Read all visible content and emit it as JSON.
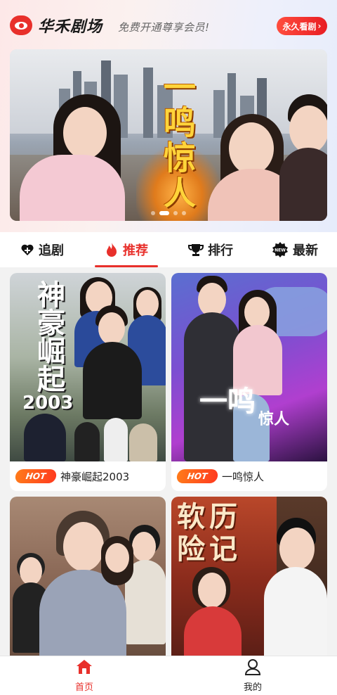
{
  "header": {
    "app_name": "华禾剧场",
    "slogan": "免费开通尊享会员!",
    "vip_button": "永久看剧"
  },
  "banner": {
    "title": "一鸣惊人"
  },
  "tabs": [
    {
      "label": "追剧",
      "icon": "heart-plus-icon",
      "active": false
    },
    {
      "label": "推荐",
      "icon": "flame-icon",
      "active": true
    },
    {
      "label": "排行",
      "icon": "trophy-icon",
      "active": false
    },
    {
      "label": "最新",
      "icon": "new-badge-icon",
      "active": false
    }
  ],
  "cards": [
    {
      "badge": "HOT",
      "title": "神豪崛起2003",
      "poster_text": "神豪崛起",
      "poster_year": "2003"
    },
    {
      "badge": "HOT",
      "title": "一鸣惊人",
      "poster_text_a": "一鸣",
      "poster_text_b": "惊人"
    },
    {
      "badge": "",
      "title": "",
      "poster_text": ""
    },
    {
      "badge": "",
      "title": "",
      "poster_text": "软历险记"
    }
  ],
  "bottom_nav": [
    {
      "label": "首页",
      "icon": "home-icon",
      "active": true
    },
    {
      "label": "我的",
      "icon": "user-icon",
      "active": false
    }
  ],
  "colors": {
    "accent": "#e8302b",
    "hot_badge": "#ff5a1f"
  }
}
